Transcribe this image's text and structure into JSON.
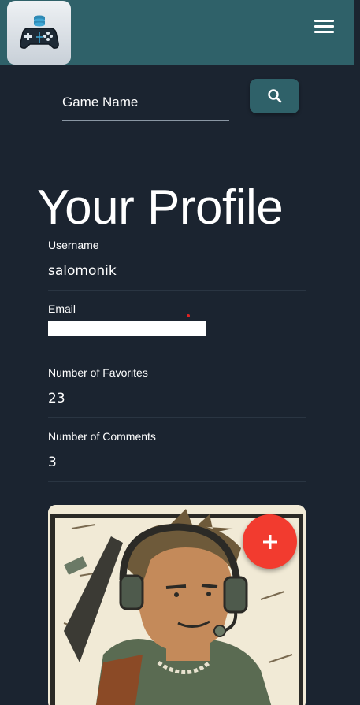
{
  "header": {
    "logo_icon": "gamepad-database-logo",
    "menu_icon": "hamburger-menu-icon",
    "bar_color": "#2f6169"
  },
  "search": {
    "placeholder": "Game Name",
    "button_icon": "search-icon"
  },
  "profile": {
    "title": "Your Profile",
    "fields": [
      {
        "label": "Username",
        "value": "salomonik"
      },
      {
        "label": "Email",
        "value": ""
      },
      {
        "label": "Number of Favorites",
        "value": "23"
      },
      {
        "label": "Number of Comments",
        "value": "3"
      }
    ],
    "avatar_icon": "gamer-headset-avatar"
  },
  "fab": {
    "icon": "plus-icon",
    "color": "#f23b2f"
  }
}
